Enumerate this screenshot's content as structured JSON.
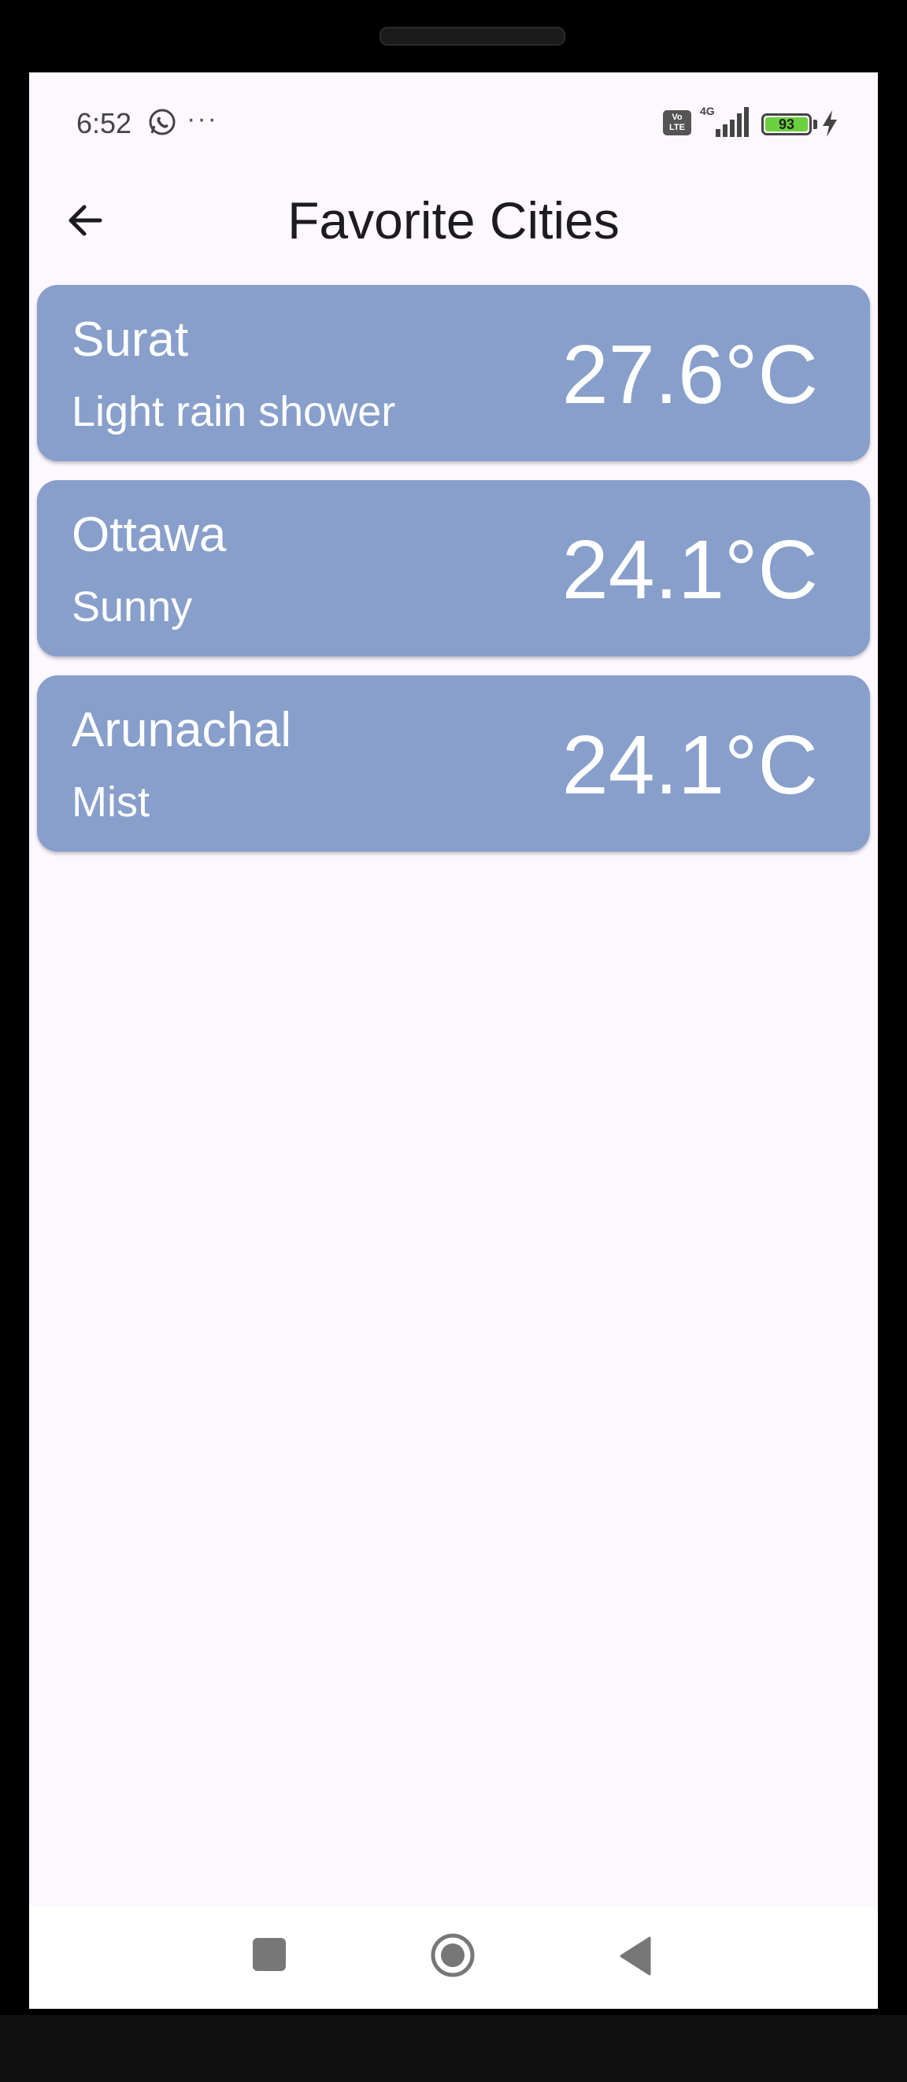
{
  "status_bar": {
    "time": "6:52",
    "more_indicator": "···",
    "volte_label": "Vo LTE",
    "network_label": "4G",
    "battery_level": "93"
  },
  "app_bar": {
    "title": "Favorite Cities",
    "back_icon": "arrow-left-icon"
  },
  "cities": [
    {
      "name": "Surat",
      "condition": "Light rain shower",
      "temperature": "27.6°C"
    },
    {
      "name": "Ottawa",
      "condition": "Sunny",
      "temperature": "24.1°C"
    },
    {
      "name": "Arunachal",
      "condition": "Mist",
      "temperature": "24.1°C"
    }
  ],
  "nav_bar": {
    "recents_icon": "square-icon",
    "home_icon": "circle-icon",
    "back_icon": "triangle-back-icon"
  },
  "colors": {
    "background": "#fdf7ff",
    "card": "#879fca",
    "card_text": "#ffffff",
    "title_text": "#1c1b1f",
    "battery_fill": "#6ad13e"
  }
}
